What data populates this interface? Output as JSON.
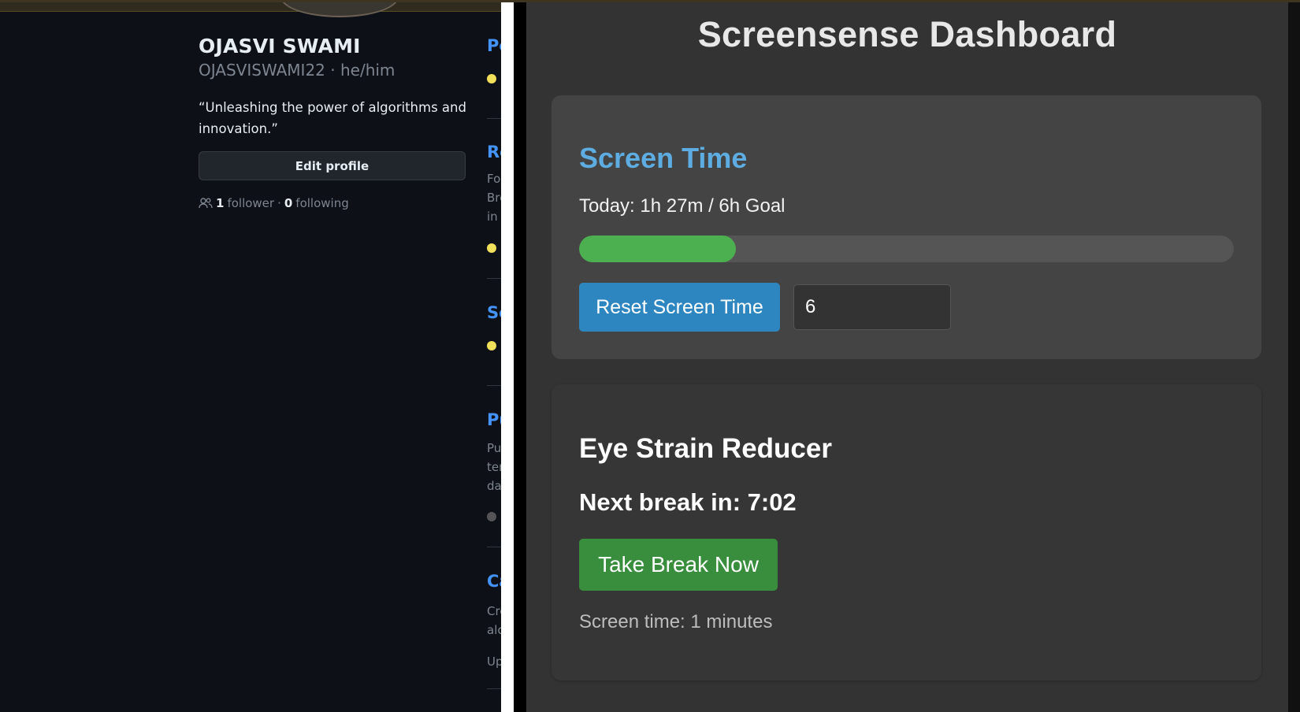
{
  "profile": {
    "name": "OJASVI SWAMI",
    "handle": "OJASVISWAMI22 · he/him",
    "bio": "“Unleashing the power of algorithms and innovation.”",
    "edit_label": "Edit profile",
    "followers_count": "1",
    "followers_label": "follower",
    "separator": "·",
    "following_count": "0",
    "following_label": "following"
  },
  "repos": [
    {
      "title": "Pe",
      "desc": [],
      "lang_color": "#f1e05a"
    },
    {
      "title": "Re",
      "desc": [
        "Fo",
        "Bre",
        "in"
      ],
      "lang_color": "#f1e05a"
    },
    {
      "title": "Sc",
      "desc": [],
      "lang_color": "#f1e05a"
    },
    {
      "title": "Pu",
      "desc": [
        "Pu",
        "ter",
        "da"
      ],
      "lang_color": "#555555"
    },
    {
      "title": "Ca",
      "desc": [
        "Cre",
        "alc"
      ],
      "lang_color": null
    },
    {
      "title": "",
      "desc": [
        "Up"
      ],
      "lang_color": null
    }
  ],
  "dashboard": {
    "title": "Screensense Dashboard",
    "screen_time": {
      "heading": "Screen Time",
      "today_text": "Today: 1h 27m / 6h Goal",
      "progress_fraction": 0.24,
      "reset_label": "Reset Screen Time",
      "goal_value": "6",
      "accent_color": "#5dade2",
      "progress_color": "#4caf50"
    },
    "eye_strain": {
      "heading": "Eye Strain Reducer",
      "next_break": "Next break in: 7:02",
      "break_label": "Take Break Now",
      "screen_time_text": "Screen time: 1 minutes",
      "button_color": "#388e3c"
    }
  }
}
